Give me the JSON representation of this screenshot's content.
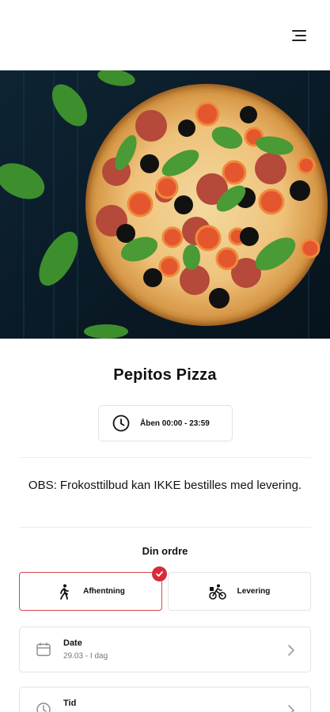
{
  "header": {
    "menu_icon": "hamburger-menu-icon"
  },
  "restaurant": {
    "name": "Pepitos Pizza",
    "hours_icon": "clock-icon",
    "hours": "Åben 00:00 - 23:59"
  },
  "notice": "OBS: Frokosttilbud kan IKKE bestilles med levering.",
  "order": {
    "heading": "Din ordre",
    "options": [
      {
        "label": "Afhentning",
        "icon": "walking-person-icon",
        "selected": true
      },
      {
        "label": "Levering",
        "icon": "cyclist-icon",
        "selected": false
      }
    ],
    "selected_badge_icon": "checkmark-icon"
  },
  "fields": {
    "date": {
      "label": "Date",
      "value": "29.03 - I dag",
      "icon": "calendar-icon"
    },
    "time": {
      "label": "Tid",
      "value": "",
      "icon": "clock-icon"
    }
  },
  "colors": {
    "accent": "#d72b39",
    "selected_border": "#d6454b",
    "border": "#e3e3e3",
    "text": "#111111",
    "muted": "#777777"
  }
}
